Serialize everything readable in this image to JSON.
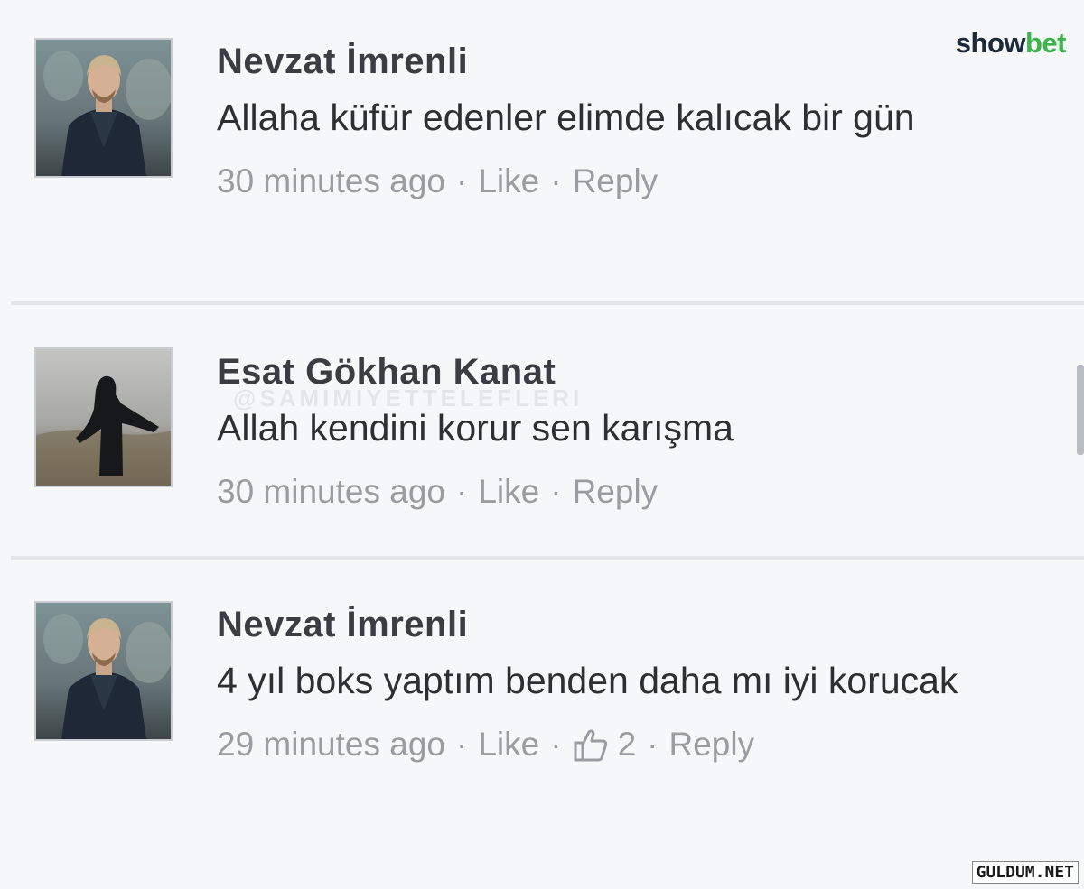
{
  "logo": {
    "part1": "show",
    "part2": "bet"
  },
  "footer_mark": "GULDUM.NET",
  "watermark": "@SAMIMIYETTELEFLERI",
  "comments": [
    {
      "author": "Nevzat İmrenli",
      "text": "Allaha küfür edenler elimde kalıcak bir gün",
      "time": "30 minutes ago",
      "like_label": "Like",
      "reply_label": "Reply"
    },
    {
      "author": "Esat Gökhan Kanat",
      "text": "Allah kendini korur sen karışma",
      "time": "30 minutes ago",
      "like_label": "Like",
      "reply_label": "Reply"
    },
    {
      "author": "Nevzat İmrenli",
      "text": "4 yıl boks yaptım benden daha mı iyi korucak",
      "time": "29 minutes ago",
      "like_label": "Like",
      "like_count": "2",
      "reply_label": "Reply"
    }
  ],
  "separator": "·",
  "icons": {
    "like": "thumbs-up-icon"
  }
}
